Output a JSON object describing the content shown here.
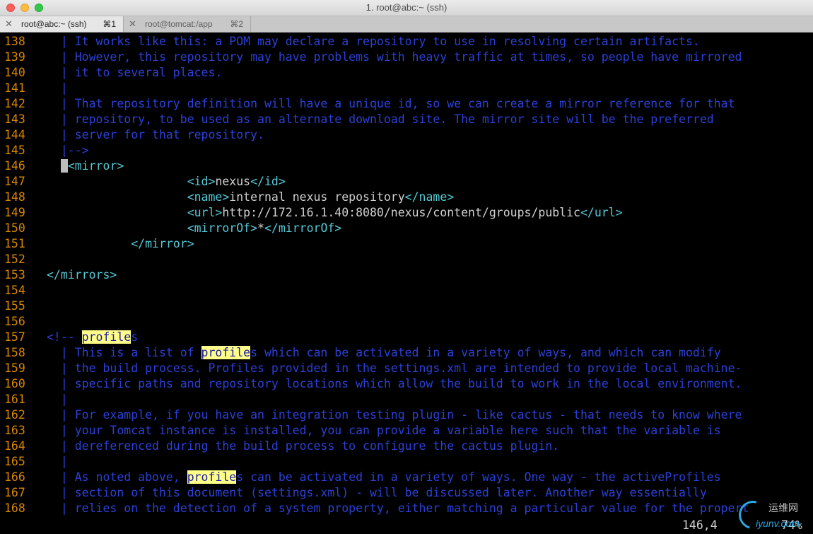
{
  "window": {
    "title": "1. root@abc:~ (ssh)"
  },
  "tabs": [
    {
      "label": "root@abc:~ (ssh)",
      "shortcut": "⌘1",
      "close": "✕"
    },
    {
      "label": "root@tomcat:/applic...",
      "shortcut": "⌘2",
      "close": "✕"
    }
  ],
  "lines": [
    {
      "n": "138",
      "parts": [
        {
          "c": "cmt",
          "t": "  | It works like this: a POM may declare a repository to use in resolving certain artifacts."
        }
      ]
    },
    {
      "n": "139",
      "parts": [
        {
          "c": "cmt",
          "t": "  | However, this repository may have problems with heavy traffic at times, so people have mirrored"
        }
      ]
    },
    {
      "n": "140",
      "parts": [
        {
          "c": "cmt",
          "t": "  | it to several places."
        }
      ]
    },
    {
      "n": "141",
      "parts": [
        {
          "c": "cmt",
          "t": "  |"
        }
      ]
    },
    {
      "n": "142",
      "parts": [
        {
          "c": "cmt",
          "t": "  | That repository definition will have a unique id, so we can create a mirror reference for that"
        }
      ]
    },
    {
      "n": "143",
      "parts": [
        {
          "c": "cmt",
          "t": "  | repository, to be used as an alternate download site. The mirror site will be the preferred"
        }
      ]
    },
    {
      "n": "144",
      "parts": [
        {
          "c": "cmt",
          "t": "  | server for that repository."
        }
      ]
    },
    {
      "n": "145",
      "parts": [
        {
          "c": "cmt",
          "t": "  |-->"
        }
      ]
    },
    {
      "n": "146",
      "parts": [
        {
          "c": "val",
          "t": "  "
        },
        {
          "c": "cursor",
          "t": " "
        },
        {
          "c": "tag",
          "t": "<mirror>"
        }
      ]
    },
    {
      "n": "147",
      "parts": [
        {
          "c": "val",
          "t": "                    "
        },
        {
          "c": "tag",
          "t": "<id>"
        },
        {
          "c": "val",
          "t": "nexus"
        },
        {
          "c": "tag",
          "t": "</id>"
        }
      ]
    },
    {
      "n": "148",
      "parts": [
        {
          "c": "val",
          "t": "                    "
        },
        {
          "c": "tag",
          "t": "<name>"
        },
        {
          "c": "val",
          "t": "internal nexus repository"
        },
        {
          "c": "tag",
          "t": "</name>"
        }
      ]
    },
    {
      "n": "149",
      "parts": [
        {
          "c": "val",
          "t": "                    "
        },
        {
          "c": "tag",
          "t": "<url>"
        },
        {
          "c": "val",
          "t": "http://172.16.1.40:8080/nexus/content/groups/public"
        },
        {
          "c": "tag",
          "t": "</url>"
        }
      ]
    },
    {
      "n": "150",
      "parts": [
        {
          "c": "val",
          "t": "                    "
        },
        {
          "c": "tag",
          "t": "<mirrorOf>"
        },
        {
          "c": "val",
          "t": "*"
        },
        {
          "c": "tag",
          "t": "</mirrorOf>"
        }
      ]
    },
    {
      "n": "151",
      "parts": [
        {
          "c": "val",
          "t": "            "
        },
        {
          "c": "tag",
          "t": "</mirror>"
        }
      ]
    },
    {
      "n": "152",
      "parts": []
    },
    {
      "n": "153",
      "parts": [
        {
          "c": "tag",
          "t": "</mirrors>"
        }
      ]
    },
    {
      "n": "154",
      "parts": []
    },
    {
      "n": "155",
      "parts": []
    },
    {
      "n": "156",
      "parts": []
    },
    {
      "n": "157",
      "parts": [
        {
          "c": "cmt",
          "t": "<!-- "
        },
        {
          "c": "hl",
          "t": "profile"
        },
        {
          "c": "cmt",
          "t": "s"
        }
      ]
    },
    {
      "n": "158",
      "parts": [
        {
          "c": "cmt",
          "t": "  | This is a list of "
        },
        {
          "c": "hl",
          "t": "profile"
        },
        {
          "c": "cmt",
          "t": "s which can be activated in a variety of ways, and which can modify"
        }
      ]
    },
    {
      "n": "159",
      "parts": [
        {
          "c": "cmt",
          "t": "  | the build process. Profiles provided in the settings.xml are intended to provide local machine-"
        }
      ]
    },
    {
      "n": "160",
      "parts": [
        {
          "c": "cmt",
          "t": "  | specific paths and repository locations which allow the build to work in the local environment."
        }
      ]
    },
    {
      "n": "161",
      "parts": [
        {
          "c": "cmt",
          "t": "  |"
        }
      ]
    },
    {
      "n": "162",
      "parts": [
        {
          "c": "cmt",
          "t": "  | For example, if you have an integration testing plugin - like cactus - that needs to know where"
        }
      ]
    },
    {
      "n": "163",
      "parts": [
        {
          "c": "cmt",
          "t": "  | your Tomcat instance is installed, you can provide a variable here such that the variable is"
        }
      ]
    },
    {
      "n": "164",
      "parts": [
        {
          "c": "cmt",
          "t": "  | dereferenced during the build process to configure the cactus plugin."
        }
      ]
    },
    {
      "n": "165",
      "parts": [
        {
          "c": "cmt",
          "t": "  |"
        }
      ]
    },
    {
      "n": "166",
      "parts": [
        {
          "c": "cmt",
          "t": "  | As noted above, "
        },
        {
          "c": "hl",
          "t": "profile"
        },
        {
          "c": "cmt",
          "t": "s can be activated in a variety of ways. One way - the activeProfiles"
        }
      ]
    },
    {
      "n": "167",
      "parts": [
        {
          "c": "cmt",
          "t": "  | section of this document (settings.xml) - will be discussed later. Another way essentially"
        }
      ]
    },
    {
      "n": "168",
      "parts": [
        {
          "c": "cmt",
          "t": "  | relies on the detection of a system property, either matching a particular value for the propert"
        }
      ]
    }
  ],
  "status": {
    "position": "146,4",
    "percent": "74%"
  },
  "watermark": {
    "cn": "运维网",
    "en": "iyunv.com"
  }
}
